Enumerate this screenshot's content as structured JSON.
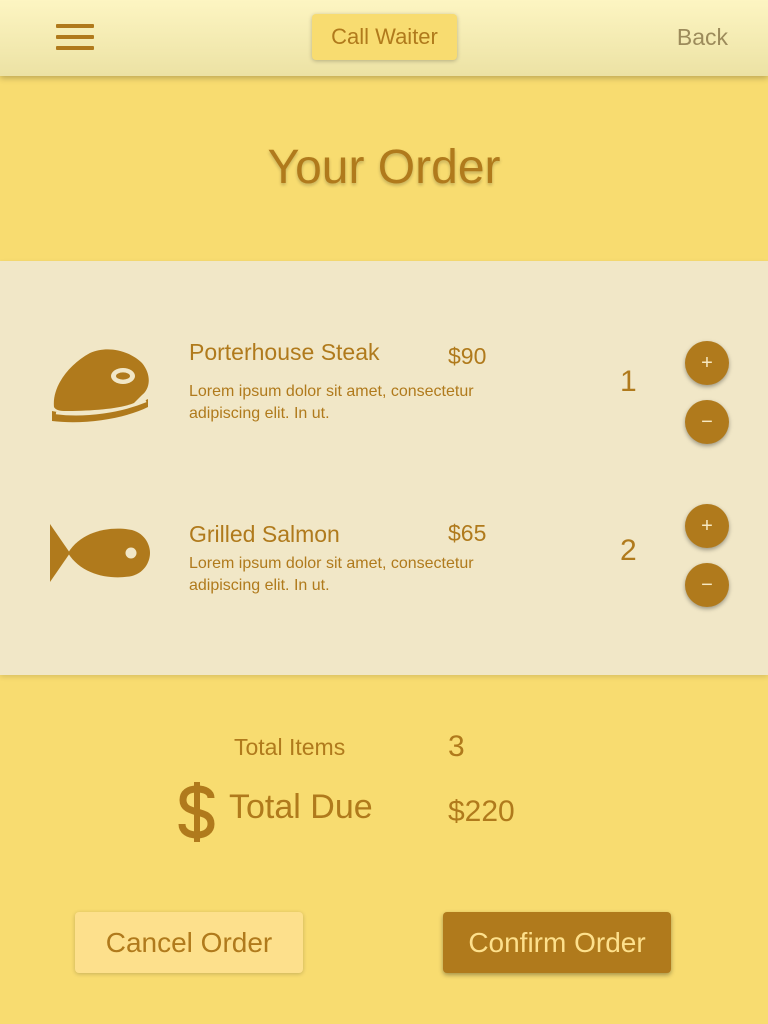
{
  "header": {
    "call_waiter_label": "Call Waiter",
    "back_label": "Back"
  },
  "page_title": "Your Order",
  "order_items": [
    {
      "name": "Porterhouse Steak",
      "price": "$90",
      "description": "Lorem ipsum dolor sit amet, consectetur adipiscing elit. In ut.",
      "quantity": "1",
      "icon": "steak-icon",
      "increase_label": "+",
      "decrease_label": "−"
    },
    {
      "name": "Grilled Salmon",
      "price": "$65",
      "description": "Lorem ipsum dolor sit amet, consectetur adipiscing elit. In ut.",
      "quantity": "2",
      "icon": "fish-icon",
      "increase_label": "+",
      "decrease_label": "−"
    }
  ],
  "totals": {
    "items_label": "Total Items",
    "items_value": "3",
    "due_label": "Total Due",
    "due_value": "$220",
    "due_icon": "dollar-icon"
  },
  "actions": {
    "cancel_label": "Cancel Order",
    "confirm_label": "Confirm Order"
  },
  "colors": {
    "background": "#f8dc70",
    "header": "#f6eeb8",
    "panel": "#f1e7c7",
    "accent": "#b07a1c",
    "cancel_button": "#fde08c"
  }
}
